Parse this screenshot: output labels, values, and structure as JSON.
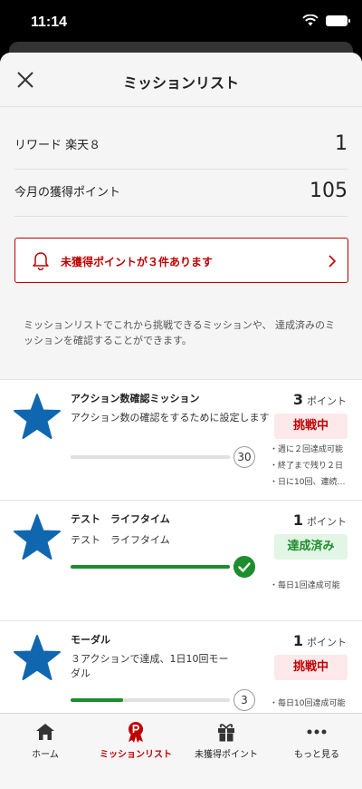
{
  "status_bar": {
    "time": "11:14"
  },
  "header": {
    "title": "ミッションリスト"
  },
  "summary": {
    "reward_label": "リワード 楽天８",
    "reward_value": "1",
    "points_label": "今月の獲得ポイント",
    "points_value": "105"
  },
  "alert": {
    "text": "未獲得ポイントが３件あります"
  },
  "description": "ミッションリストでこれから挑戦できるミッションや、 達成済みのミッションを確認することができます。",
  "missions": [
    {
      "title": "アクション数確認ミッション",
      "subtitle": "アクション数の確認をするために設定します",
      "points": "3",
      "points_unit": "ポイント",
      "status": "挑戦中",
      "progress": 0,
      "count": "30",
      "notes": [
        "・週に２回達成可能",
        "・終了まで残り２日",
        "・日に10回、連続…"
      ]
    },
    {
      "title": "テスト　ライフタイム",
      "subtitle": "テスト　ライフタイム",
      "points": "1",
      "points_unit": "ポイント",
      "status": "達成済み",
      "progress": 1.0,
      "count": "",
      "notes": [
        "・毎日1回達成可能"
      ]
    },
    {
      "title": "モーダル",
      "subtitle": "３アクションで達成、1日10回モーダル",
      "points": "1",
      "points_unit": "ポイント",
      "status": "挑戦中",
      "progress": 0.33,
      "count": "3",
      "notes": [
        "・毎日10回達成可能"
      ]
    }
  ],
  "tabs": [
    {
      "label": "ホーム",
      "icon": "home-icon",
      "active": false
    },
    {
      "label": "ミッションリスト",
      "icon": "mission-medal-icon",
      "active": true
    },
    {
      "label": "未獲得ポイント",
      "icon": "gift-icon",
      "active": false
    },
    {
      "label": "もっと見る",
      "icon": "more-icon",
      "active": false
    }
  ],
  "colors": {
    "accent": "#bf0000",
    "success": "#1d8d2e",
    "star": "#1067b0"
  }
}
